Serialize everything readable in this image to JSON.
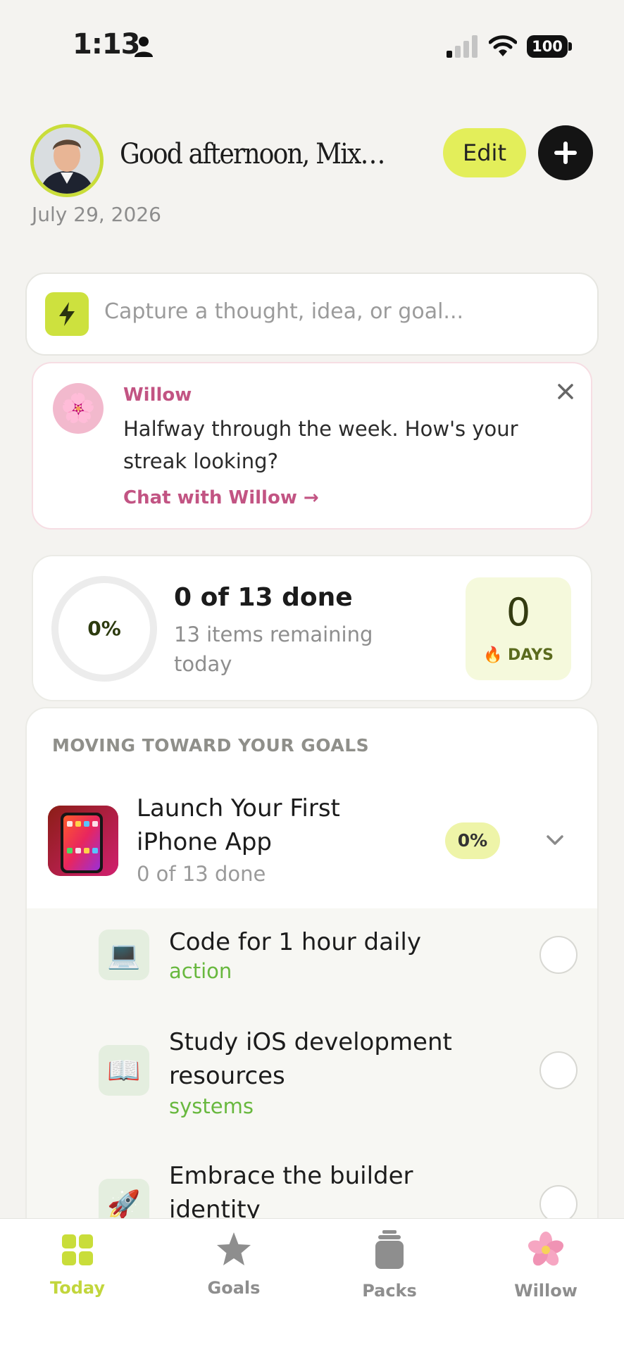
{
  "status_bar": {
    "time": "1:13",
    "battery": "100"
  },
  "header": {
    "greeting": "Good afternoon, Mixdow...",
    "edit_label": "Edit",
    "date": "July 29, 2026"
  },
  "capture": {
    "placeholder": "Capture a thought, idea, or goal..."
  },
  "willow_card": {
    "name": "Willow",
    "message": "Halfway through the week. How's your streak looking?",
    "link": "Chat with Willow →",
    "avatar_emoji": "🌸"
  },
  "progress": {
    "percent_label": "0%",
    "percent_value": 0,
    "done_title": "0 of 13 done",
    "remaining": "13 items remaining today",
    "streak_count": "0",
    "streak_label": "🔥 DAYS"
  },
  "goals": {
    "section_heading": "MOVING TOWARD YOUR GOALS",
    "goal": {
      "title": "Launch Your First iPhone App",
      "subtitle": "0 of 13 done",
      "badge": "0%"
    },
    "tasks": [
      {
        "icon": "💻",
        "title": "Code for 1 hour daily",
        "tag": "action"
      },
      {
        "icon": "📖",
        "title": "Study iOS development resources",
        "tag": "systems"
      },
      {
        "icon": "🚀",
        "title": "Embrace the builder identity",
        "tag": ""
      }
    ]
  },
  "tab_bar": {
    "tabs": [
      {
        "label": "Today",
        "icon": "grid-icon",
        "active": true
      },
      {
        "label": "Goals",
        "icon": "star-icon",
        "active": false
      },
      {
        "label": "Packs",
        "icon": "packs-icon",
        "active": false
      },
      {
        "label": "Willow",
        "icon": "blossom-icon",
        "active": false
      }
    ]
  },
  "colors": {
    "accent_lime": "#c9dd3a",
    "willow_pink": "#c25483",
    "tag_green": "#68b83e",
    "background": "#f4f3f0"
  }
}
